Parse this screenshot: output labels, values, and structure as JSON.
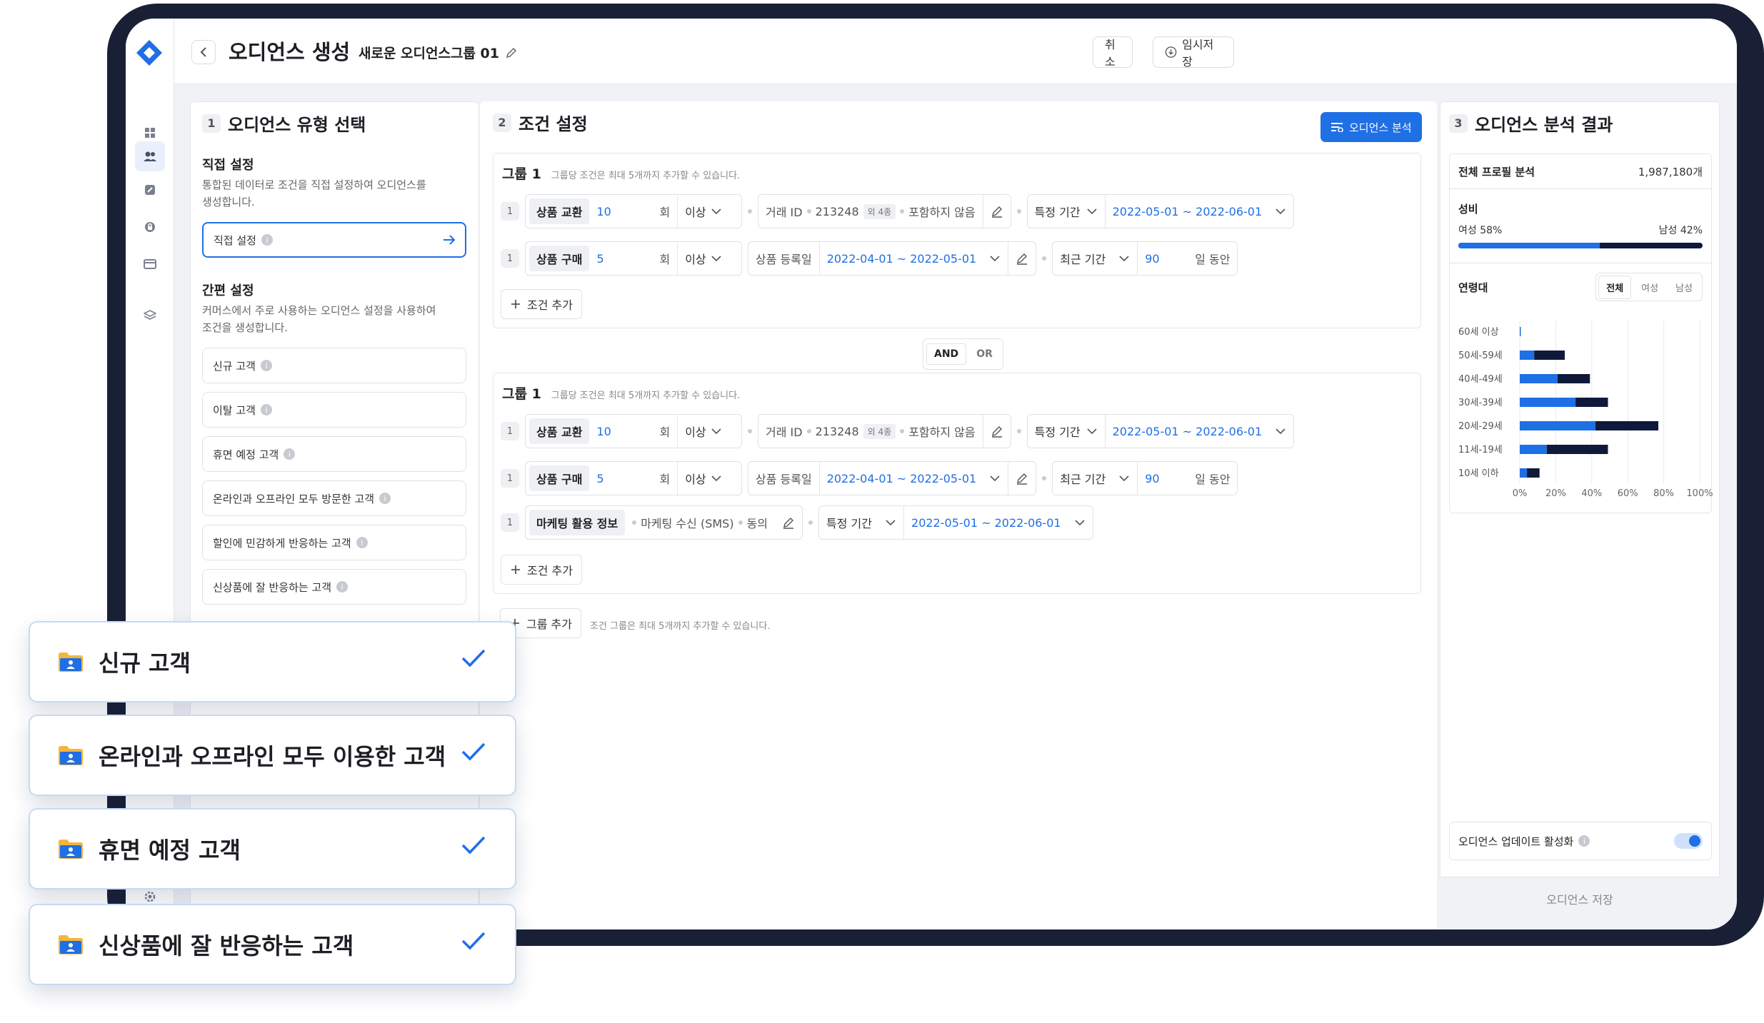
{
  "header": {
    "title": "오디언스 생성",
    "group_name": "새로운 오디언스그룹 01",
    "cancel_label": "취소",
    "draft_label": "임시저장"
  },
  "step1": {
    "num": "1",
    "title": "오디언스 유형 선택",
    "direct_heading": "직접 설정",
    "direct_desc_1": "통합된 데이터로 조건을 직접 설정하여 오디언스를",
    "direct_desc_2": "생성합니다.",
    "direct_option": "직접 설정",
    "quick_heading": "간편 설정",
    "quick_desc_1": "커머스에서 주로 사용하는 오디언스 설정을 사용하여",
    "quick_desc_2": "조건을 생성합니다.",
    "options": [
      "신규 고객",
      "이탈 고객",
      "휴면 예정 고객",
      "온라인과 오프라인 모두 방문한 고객",
      "할인에 민감하게 반응하는 고객",
      "신상품에 잘 반응하는 고객"
    ]
  },
  "step2": {
    "num": "2",
    "title": "조건 설정",
    "analyze_label": "오디언스 분석",
    "group_title": "그룹 1",
    "group_hint": "그룹당 조건은 최대 5개까지 추가할 수 있습니다.",
    "r1_num": "1",
    "r1_chip": "상품 교환",
    "r1_count": "10",
    "r1_unit": "회",
    "r1_op": "이상",
    "r1_filter": "거래 ID",
    "r1_id": "213248",
    "r1_extra": "외 4종",
    "r1_exclude": "포함하지 않음",
    "r1_period": "특정 기간",
    "r1_range": "2022-05-01 ~ 2022-06-01",
    "r2_num": "1",
    "r2_chip": "상품 구매",
    "r2_count": "5",
    "r2_unit": "회",
    "r2_op": "이상",
    "r2_filter": "상품 등록일",
    "r2_range": "2022-04-01 ~ 2022-05-01",
    "r2_period": "최근 기간",
    "r2_days": "90",
    "r2_days_unit": "일 동안",
    "r3_num": "1",
    "r3_chip": "마케팅 활용 정보",
    "r3_filter": "마케팅 수신 (SMS)",
    "r3_value": "동의",
    "r3_period": "특정 기간",
    "r3_range": "2022-05-01 ~ 2022-06-01",
    "add_condition": "조건 추가",
    "and_label": "AND",
    "or_label": "OR",
    "add_group": "그룹 추가",
    "add_group_hint": "조건 그룹은 최대 5개까지 추가할 수 있습니다."
  },
  "step3": {
    "num": "3",
    "title": "오디언스 분석 결과",
    "total_label": "전체 프로필 분석",
    "total_value": "1,987,180개",
    "gender_label": "성비",
    "female_label": "여성 58%",
    "male_label": "남성 42%",
    "female_share": 0.58,
    "age_label": "연령대",
    "tabs": [
      "전체",
      "여성",
      "남성"
    ],
    "age_groups": [
      "60세 이상",
      "50세-59세",
      "40세-49세",
      "30세-39세",
      "20세-29세",
      "11세-19세",
      "10세 이하"
    ],
    "age_female_pct": [
      0.5,
      8,
      21,
      31,
      42,
      15,
      4
    ],
    "age_male_pct": [
      0,
      17,
      18,
      18,
      35,
      34,
      7
    ],
    "x_ticks": [
      "0%",
      "20%",
      "40%",
      "60%",
      "80%",
      "100%"
    ],
    "update_label": "오디언스 업데이트 활성화",
    "save_label": "오디언스 저장",
    "female_color": "#1f6fe5",
    "male_color": "#0f1a3a"
  },
  "overlay_cards": [
    "신규 고객",
    "온라인과 오프라인 모두 이용한 고객",
    "휴면 예정 고객",
    "신상품에 잘 반응하는 고객"
  ]
}
